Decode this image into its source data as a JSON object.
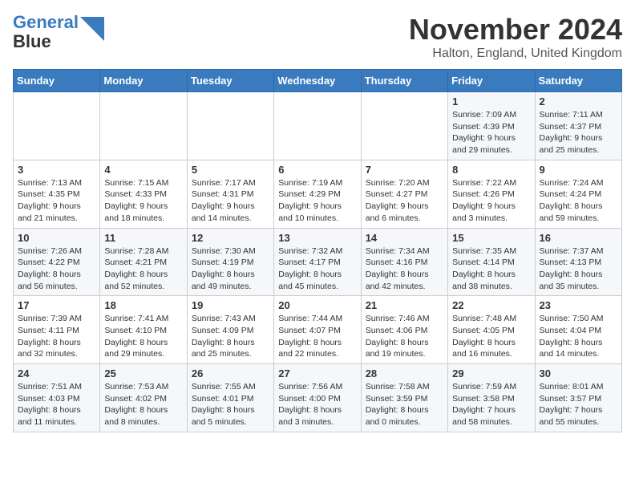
{
  "logo": {
    "line1": "General",
    "line2": "Blue"
  },
  "title": "November 2024",
  "location": "Halton, England, United Kingdom",
  "days_of_week": [
    "Sunday",
    "Monday",
    "Tuesday",
    "Wednesday",
    "Thursday",
    "Friday",
    "Saturday"
  ],
  "weeks": [
    [
      {
        "day": "",
        "info": ""
      },
      {
        "day": "",
        "info": ""
      },
      {
        "day": "",
        "info": ""
      },
      {
        "day": "",
        "info": ""
      },
      {
        "day": "",
        "info": ""
      },
      {
        "day": "1",
        "info": "Sunrise: 7:09 AM\nSunset: 4:39 PM\nDaylight: 9 hours and 29 minutes."
      },
      {
        "day": "2",
        "info": "Sunrise: 7:11 AM\nSunset: 4:37 PM\nDaylight: 9 hours and 25 minutes."
      }
    ],
    [
      {
        "day": "3",
        "info": "Sunrise: 7:13 AM\nSunset: 4:35 PM\nDaylight: 9 hours and 21 minutes."
      },
      {
        "day": "4",
        "info": "Sunrise: 7:15 AM\nSunset: 4:33 PM\nDaylight: 9 hours and 18 minutes."
      },
      {
        "day": "5",
        "info": "Sunrise: 7:17 AM\nSunset: 4:31 PM\nDaylight: 9 hours and 14 minutes."
      },
      {
        "day": "6",
        "info": "Sunrise: 7:19 AM\nSunset: 4:29 PM\nDaylight: 9 hours and 10 minutes."
      },
      {
        "day": "7",
        "info": "Sunrise: 7:20 AM\nSunset: 4:27 PM\nDaylight: 9 hours and 6 minutes."
      },
      {
        "day": "8",
        "info": "Sunrise: 7:22 AM\nSunset: 4:26 PM\nDaylight: 9 hours and 3 minutes."
      },
      {
        "day": "9",
        "info": "Sunrise: 7:24 AM\nSunset: 4:24 PM\nDaylight: 8 hours and 59 minutes."
      }
    ],
    [
      {
        "day": "10",
        "info": "Sunrise: 7:26 AM\nSunset: 4:22 PM\nDaylight: 8 hours and 56 minutes."
      },
      {
        "day": "11",
        "info": "Sunrise: 7:28 AM\nSunset: 4:21 PM\nDaylight: 8 hours and 52 minutes."
      },
      {
        "day": "12",
        "info": "Sunrise: 7:30 AM\nSunset: 4:19 PM\nDaylight: 8 hours and 49 minutes."
      },
      {
        "day": "13",
        "info": "Sunrise: 7:32 AM\nSunset: 4:17 PM\nDaylight: 8 hours and 45 minutes."
      },
      {
        "day": "14",
        "info": "Sunrise: 7:34 AM\nSunset: 4:16 PM\nDaylight: 8 hours and 42 minutes."
      },
      {
        "day": "15",
        "info": "Sunrise: 7:35 AM\nSunset: 4:14 PM\nDaylight: 8 hours and 38 minutes."
      },
      {
        "day": "16",
        "info": "Sunrise: 7:37 AM\nSunset: 4:13 PM\nDaylight: 8 hours and 35 minutes."
      }
    ],
    [
      {
        "day": "17",
        "info": "Sunrise: 7:39 AM\nSunset: 4:11 PM\nDaylight: 8 hours and 32 minutes."
      },
      {
        "day": "18",
        "info": "Sunrise: 7:41 AM\nSunset: 4:10 PM\nDaylight: 8 hours and 29 minutes."
      },
      {
        "day": "19",
        "info": "Sunrise: 7:43 AM\nSunset: 4:09 PM\nDaylight: 8 hours and 25 minutes."
      },
      {
        "day": "20",
        "info": "Sunrise: 7:44 AM\nSunset: 4:07 PM\nDaylight: 8 hours and 22 minutes."
      },
      {
        "day": "21",
        "info": "Sunrise: 7:46 AM\nSunset: 4:06 PM\nDaylight: 8 hours and 19 minutes."
      },
      {
        "day": "22",
        "info": "Sunrise: 7:48 AM\nSunset: 4:05 PM\nDaylight: 8 hours and 16 minutes."
      },
      {
        "day": "23",
        "info": "Sunrise: 7:50 AM\nSunset: 4:04 PM\nDaylight: 8 hours and 14 minutes."
      }
    ],
    [
      {
        "day": "24",
        "info": "Sunrise: 7:51 AM\nSunset: 4:03 PM\nDaylight: 8 hours and 11 minutes."
      },
      {
        "day": "25",
        "info": "Sunrise: 7:53 AM\nSunset: 4:02 PM\nDaylight: 8 hours and 8 minutes."
      },
      {
        "day": "26",
        "info": "Sunrise: 7:55 AM\nSunset: 4:01 PM\nDaylight: 8 hours and 5 minutes."
      },
      {
        "day": "27",
        "info": "Sunrise: 7:56 AM\nSunset: 4:00 PM\nDaylight: 8 hours and 3 minutes."
      },
      {
        "day": "28",
        "info": "Sunrise: 7:58 AM\nSunset: 3:59 PM\nDaylight: 8 hours and 0 minutes."
      },
      {
        "day": "29",
        "info": "Sunrise: 7:59 AM\nSunset: 3:58 PM\nDaylight: 7 hours and 58 minutes."
      },
      {
        "day": "30",
        "info": "Sunrise: 8:01 AM\nSunset: 3:57 PM\nDaylight: 7 hours and 55 minutes."
      }
    ]
  ]
}
